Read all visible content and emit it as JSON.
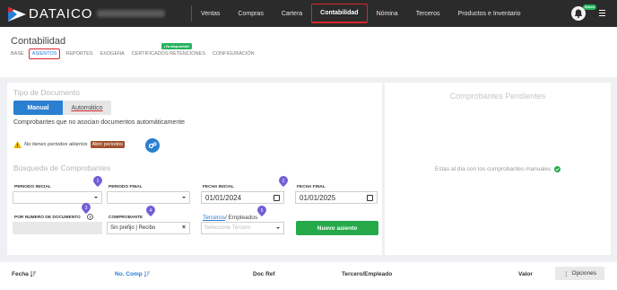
{
  "app": {
    "logo_text": "DATAICO"
  },
  "nav": {
    "items": [
      {
        "label": "Ventas"
      },
      {
        "label": "Compras"
      },
      {
        "label": "Cartera"
      },
      {
        "label": "Contabilidad",
        "active": true
      },
      {
        "label": "Nómina"
      },
      {
        "label": "Terceros"
      },
      {
        "label": "Productos e Inventario"
      }
    ],
    "notification_badge": "Nuevo"
  },
  "page": {
    "title": "Contabilidad",
    "subnav": [
      {
        "label": "BASE"
      },
      {
        "label": "ASIENTOS",
        "active": true
      },
      {
        "label": "REPORTES"
      },
      {
        "label": "EXOGENA"
      },
      {
        "label": "CERTIFICADOS RETENCIONES"
      },
      {
        "label": "CONFIGURACIÓN"
      }
    ],
    "new_badge": "¡Ya disponible!"
  },
  "doc_type": {
    "title": "Tipo de Documento",
    "manual_label": "Manual",
    "auto_label": "Automático",
    "description": "Comprobantes que no asocian documentos automáticamente",
    "warning_text": "No tienes periodos abiertos",
    "open_periods_label": "Abrir periodos"
  },
  "search": {
    "title": "Búsqueda de Comprobantes",
    "periodo_inicial_label": "PERIODO INICIAL",
    "periodo_final_label": "PERIODO FINAL",
    "fecha_inicial_label": "FECHA INICIAL",
    "fecha_inicial_value": "01/01/2024",
    "fecha_final_label": "FECHA FINAL",
    "fecha_final_value": "01/01/2025",
    "numero_label": "POR NUMERO DE DOCUMENTO",
    "comprobante_label": "COMPROBANTE",
    "comprobante_value": "Sin prefijo | Recibo",
    "terceros_link": "Terceros",
    "terceros_rest": "/ Empleados",
    "tercero_placeholder": "Seleccione Tercero",
    "new_button": "Nuevo asiento",
    "markers": [
      "1",
      "2",
      "3",
      "4",
      "5"
    ]
  },
  "pending": {
    "title": "Comprobantes Pendientes",
    "message": "Estas al día con los comprobantes manuales"
  },
  "table": {
    "columns": [
      "Fecha",
      "No. Comp",
      "Doc Ref",
      "Tercero/Empleado",
      "Valor"
    ],
    "options_label": "Opciones"
  },
  "colors": {
    "primary": "#2a7fd1",
    "success": "#25a949",
    "highlight": "#d9262c",
    "marker": "#6f5fd6"
  }
}
